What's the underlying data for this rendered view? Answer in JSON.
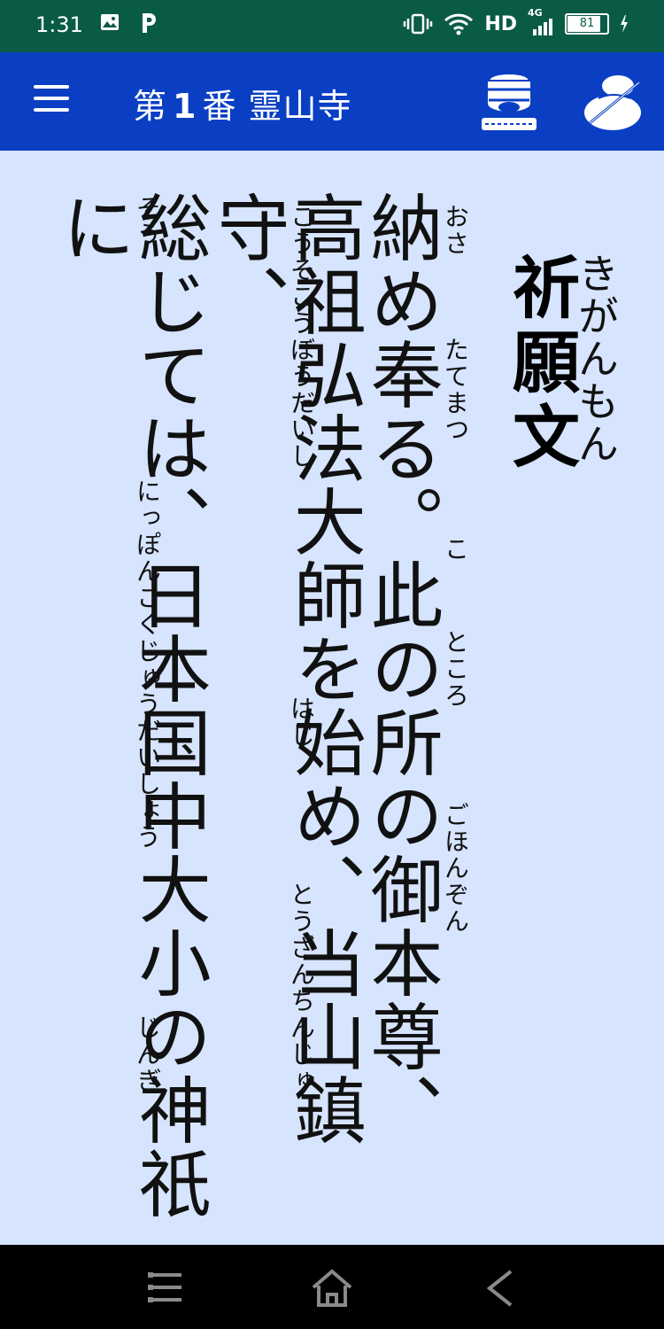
{
  "status_bar": {
    "time": "1:31",
    "network": "HD",
    "signal": "4G",
    "battery": "81",
    "icons": [
      "image-icon",
      "parking-icon",
      "vibrate-icon",
      "wifi-icon",
      "signal-icon",
      "battery-icon"
    ]
  },
  "header": {
    "title_prefix": "第",
    "number": "1",
    "title_suffix": "番 霊山寺",
    "left_icon": "menu-icon",
    "right_icons": [
      "temple-bell-icon",
      "stone-icon"
    ]
  },
  "prayer": {
    "title": "祈願文",
    "title_ruby": "きがんもん",
    "lines": [
      "納め奉る。此の所の御本尊、",
      "高祖弘法大師を始め、当山鎮守、",
      "総じては、日本国中大小の神祇に"
    ],
    "ruby": [
      [
        "おさ",
        "たてまつ",
        "こ",
        "ところ",
        "ごほんぞん"
      ],
      [
        "こうそこうぼうだいし",
        "はじ",
        "とうざんちんじゅ"
      ],
      [
        "そう",
        "にっぽんこくじゅうだいしょう",
        "じんぎ"
      ]
    ]
  },
  "nav_bar": {
    "icons": [
      "recents-icon",
      "home-icon",
      "back-icon"
    ]
  },
  "colors": {
    "status_bar": "#0a5b45",
    "app_bar": "#0a3fc4",
    "background": "#d6e4fd",
    "nav_bar": "#000000"
  }
}
